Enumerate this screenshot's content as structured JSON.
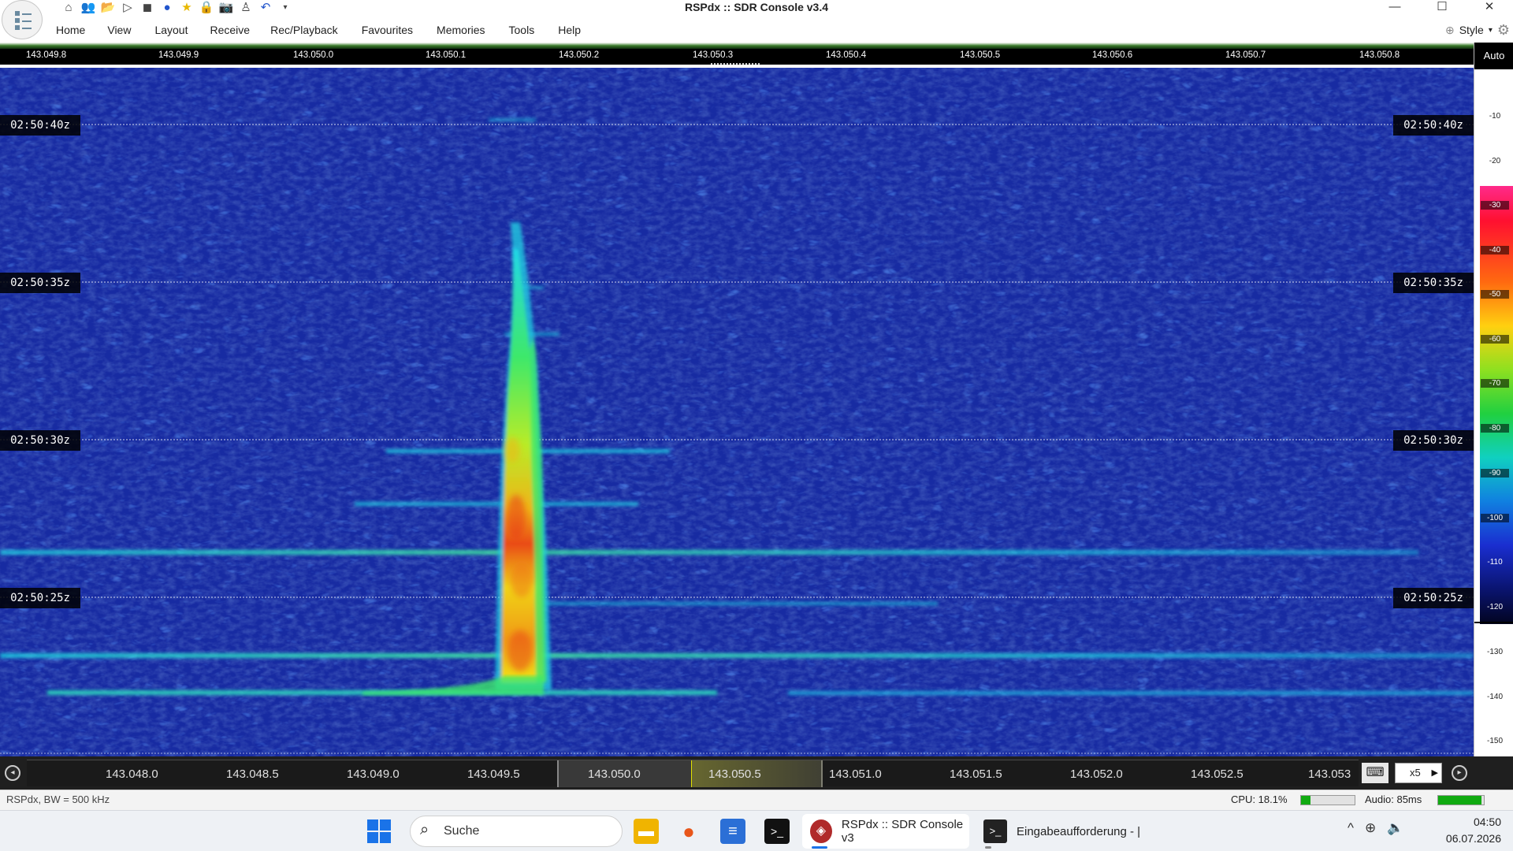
{
  "window": {
    "title": "RSPdx :: SDR Console v3.4"
  },
  "quick_access_icons": [
    "home-icon",
    "users-icon",
    "folder-icon",
    "play-icon",
    "stop-icon",
    "record-icon",
    "star-icon",
    "lock-icon",
    "camera-icon",
    "antenna-icon",
    "undo-icon",
    "dropdown-icon"
  ],
  "menu": {
    "items": [
      "Home",
      "View",
      "Layout",
      "Receive",
      "Rec/Playback",
      "Favourites",
      "Memories",
      "Tools",
      "Help"
    ],
    "style_label": "Style"
  },
  "top_ruler": {
    "ticks": [
      "143.049.8",
      "143.049.9",
      "143.050.0",
      "143.050.1",
      "143.050.2",
      "143.050.3",
      "143.050.4",
      "143.050.5",
      "143.050.6",
      "143.050.7",
      "143.050.8"
    ]
  },
  "waterfall": {
    "time_labels": [
      "02:50:40z",
      "02:50:35z",
      "02:50:30z",
      "02:50:25z"
    ],
    "colors": {
      "background": "#1b2fa8",
      "noise_dark": "#07104a",
      "signal_cyan": "#22e0e8",
      "signal_green": "#4be830",
      "signal_yellow": "#f0e41a",
      "signal_orange": "#f07818",
      "signal_red": "#e82a18"
    }
  },
  "level_scale": {
    "auto_label": "Auto",
    "labels": [
      "-10",
      "-20",
      "-30",
      "-40",
      "-50",
      "-60",
      "-70",
      "-80",
      "-90",
      "-100",
      "-110",
      "-120",
      "-130",
      "-140",
      "-150"
    ]
  },
  "bottom_ruler": {
    "ticks": [
      "143.048.0",
      "143.048.5",
      "143.049.0",
      "143.049.5",
      "143.050.0",
      "143.050.5",
      "143.051.0",
      "143.051.5",
      "143.052.0",
      "143.052.5",
      "143.053"
    ],
    "zoom_value": "x5"
  },
  "status": {
    "device_info": "RSPdx, BW = 500 kHz",
    "cpu_label": "CPU: 18.1%",
    "cpu_percent": 18.1,
    "audio_label": "Audio: 85ms",
    "audio_level": 0.95
  },
  "taskbar": {
    "search_placeholder": "Suche",
    "pinned_icons": [
      "file-explorer-icon",
      "firefox-icon",
      "notepad-icon",
      "terminal-icon"
    ],
    "apps": [
      {
        "label": "RSPdx :: SDR Console v3"
      },
      {
        "label": "Eingabeaufforderung - |"
      }
    ],
    "clock_time": "04:50",
    "clock_date": "06.07.2026"
  }
}
